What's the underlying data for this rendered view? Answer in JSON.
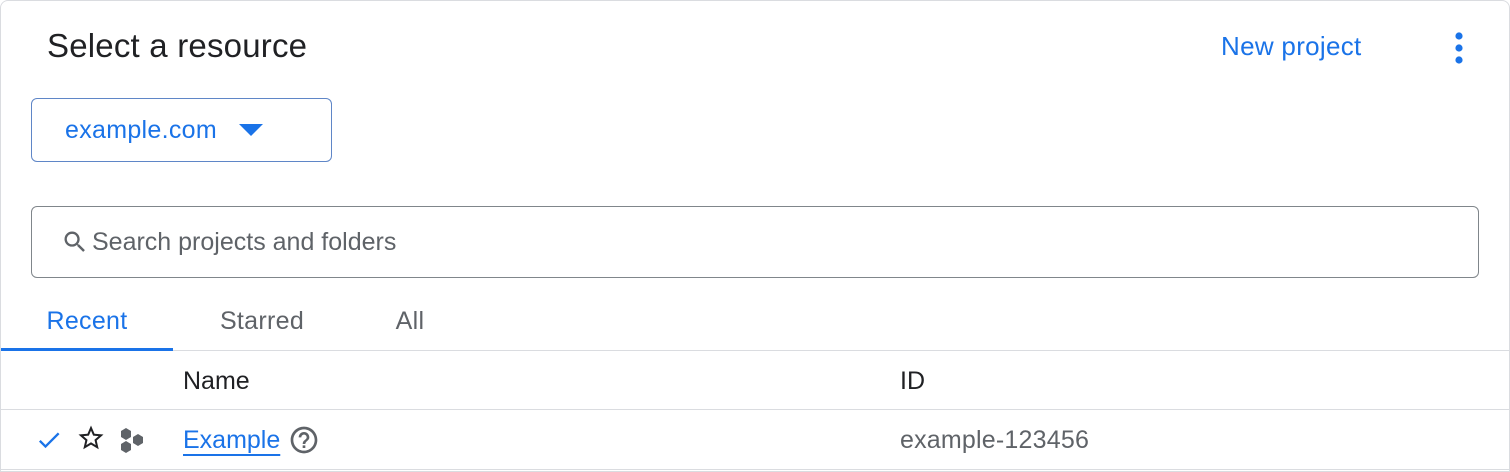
{
  "dialog": {
    "title": "Select a resource",
    "new_project_label": "New project",
    "more_icon": "more-vert-icon"
  },
  "organization": {
    "selected": "example.com",
    "icon": "arrow-drop-down-icon"
  },
  "search": {
    "placeholder": "Search projects and folders",
    "value": "",
    "icon": "search-icon"
  },
  "tabs": [
    {
      "label": "Recent",
      "active": true
    },
    {
      "label": "Starred",
      "active": false
    },
    {
      "label": "All",
      "active": false
    }
  ],
  "table": {
    "columns": [
      "Name",
      "ID"
    ],
    "rows": [
      {
        "selected": true,
        "starred": false,
        "type_icon": "project-hexagons-icon",
        "name": "Example",
        "help_icon": "help-circle-icon",
        "id": "example-123456"
      }
    ]
  },
  "colors": {
    "accent": "#1a73e8",
    "text": "#202124",
    "secondary_text": "#5f6368",
    "divider": "#dadce0"
  }
}
